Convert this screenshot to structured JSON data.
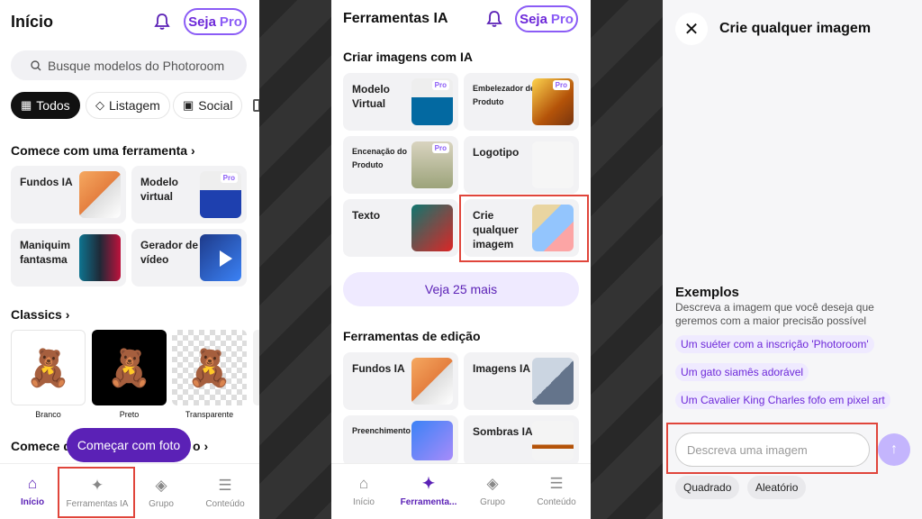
{
  "panel1": {
    "title": "Início",
    "pro_label_1": "Seja",
    "pro_label_2": "Pro",
    "search_placeholder": "Busque modelos do Photoroom",
    "chips": [
      "Todos",
      "Listagem",
      "Social"
    ],
    "section1_title": "Comece com uma ferramenta",
    "tools": [
      {
        "label": "Fundos IA",
        "pro": ""
      },
      {
        "label": "Modelo virtual",
        "pro": "Pro"
      },
      {
        "label": "Maniquim fantasma",
        "pro": ""
      },
      {
        "label": "Gerador de vídeo",
        "pro": ""
      }
    ],
    "section2_title": "Classics",
    "classics": [
      "Branco",
      "Preto",
      "Transparente"
    ],
    "section3_title_a": "Comece d",
    "section3_title_b": "o",
    "fab_label": "Começar com foto",
    "nav": [
      "Início",
      "Ferramentas IA",
      "Grupo",
      "Conteúdo"
    ]
  },
  "panel2": {
    "title": "Ferramentas IA",
    "pro_label_1": "Seja",
    "pro_label_2": "Pro",
    "section1_title": "Criar imagens com IA",
    "tools": [
      {
        "label": "Modelo Virtual",
        "pro": "Pro"
      },
      {
        "label": "Embelezador de Produto",
        "pro": "Pro"
      },
      {
        "label": "Encenação do Produto",
        "pro": "Pro"
      },
      {
        "label": "Logotipo",
        "pro": ""
      },
      {
        "label": "Texto",
        "pro": ""
      },
      {
        "label": "Crie qualquer imagem",
        "pro": ""
      }
    ],
    "see_more": "Veja 25 mais",
    "section2_title": "Ferramentas de edição",
    "edit_tools": [
      {
        "label": "Fundos IA"
      },
      {
        "label": "Imagens IA"
      },
      {
        "label": "Preenchimento IA"
      },
      {
        "label": "Sombras IA"
      }
    ],
    "nav": [
      "Início",
      "Ferramenta...",
      "Grupo",
      "Conteúdo"
    ]
  },
  "panel3": {
    "title": "Crie qualquer imagem",
    "examples_title": "Exemplos",
    "examples_desc": "Descreva a imagem que você deseja que geremos com a maior precisão possível",
    "examples": [
      "Um suéter com a inscrição 'Photoroom'",
      "Um gato siamês adorável",
      "Um Cavalier King Charles fofo em pixel art"
    ],
    "input_placeholder": "Descreva uma imagem",
    "options": [
      "Quadrado",
      "Aleatório"
    ]
  },
  "colors": {
    "accent": "#8b5cf6",
    "accent_dark": "#5b21b6",
    "highlight": "#e0453b"
  }
}
